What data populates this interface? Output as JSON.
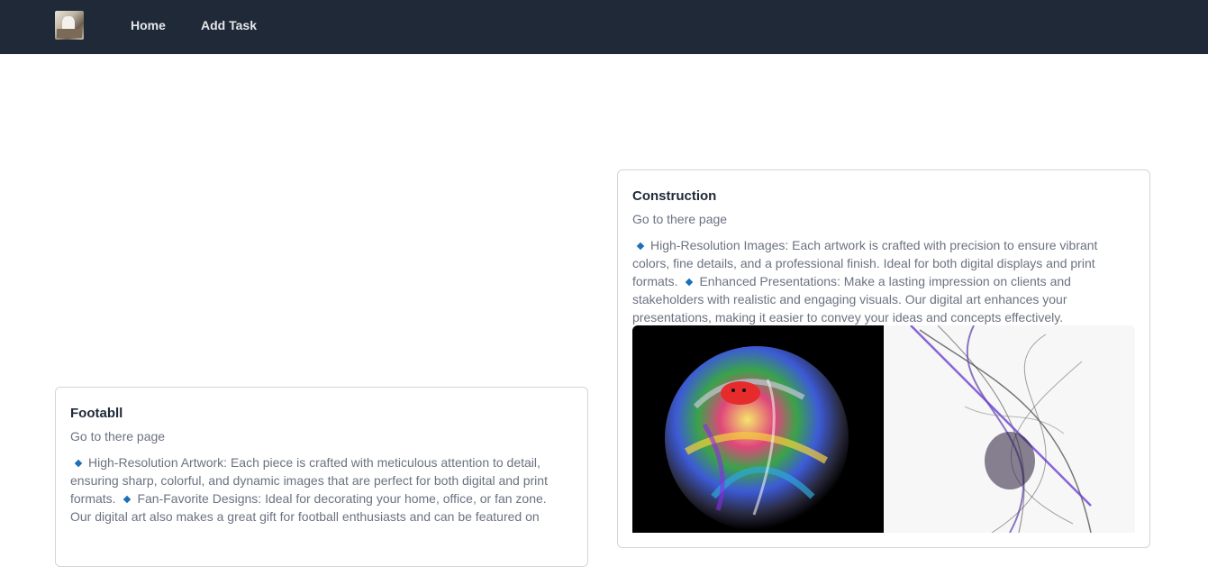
{
  "nav": {
    "home_label": "Home",
    "add_task_label": "Add Task"
  },
  "cards": [
    {
      "title": "Construction",
      "link_text": "Go to there page",
      "desc_part1": "High-Resolution Images: Each artwork is crafted with precision to ensure vibrant colors, fine details, and a professional finish. Ideal for both digital displays and print formats.",
      "desc_part2": "Enhanced Presentations: Make a lasting impression on clients and stakeholders with realistic and engaging visuals. Our digital art enhances your presentations, making it easier to convey your ideas and concepts effectively."
    },
    {
      "title": "Footabll",
      "link_text": "Go to there page",
      "desc_part1": "High-Resolution Artwork: Each piece is crafted with meticulous attention to detail, ensuring sharp, colorful, and dynamic images that are perfect for both digital and print formats.",
      "desc_part2": "Fan-Favorite Designs: Ideal for decorating your home, office, or fan zone. Our digital art also makes a great gift for football enthusiasts and can be featured on"
    }
  ],
  "colors": {
    "navbar": "#1f2937",
    "bullet": "#1d6fb8"
  }
}
